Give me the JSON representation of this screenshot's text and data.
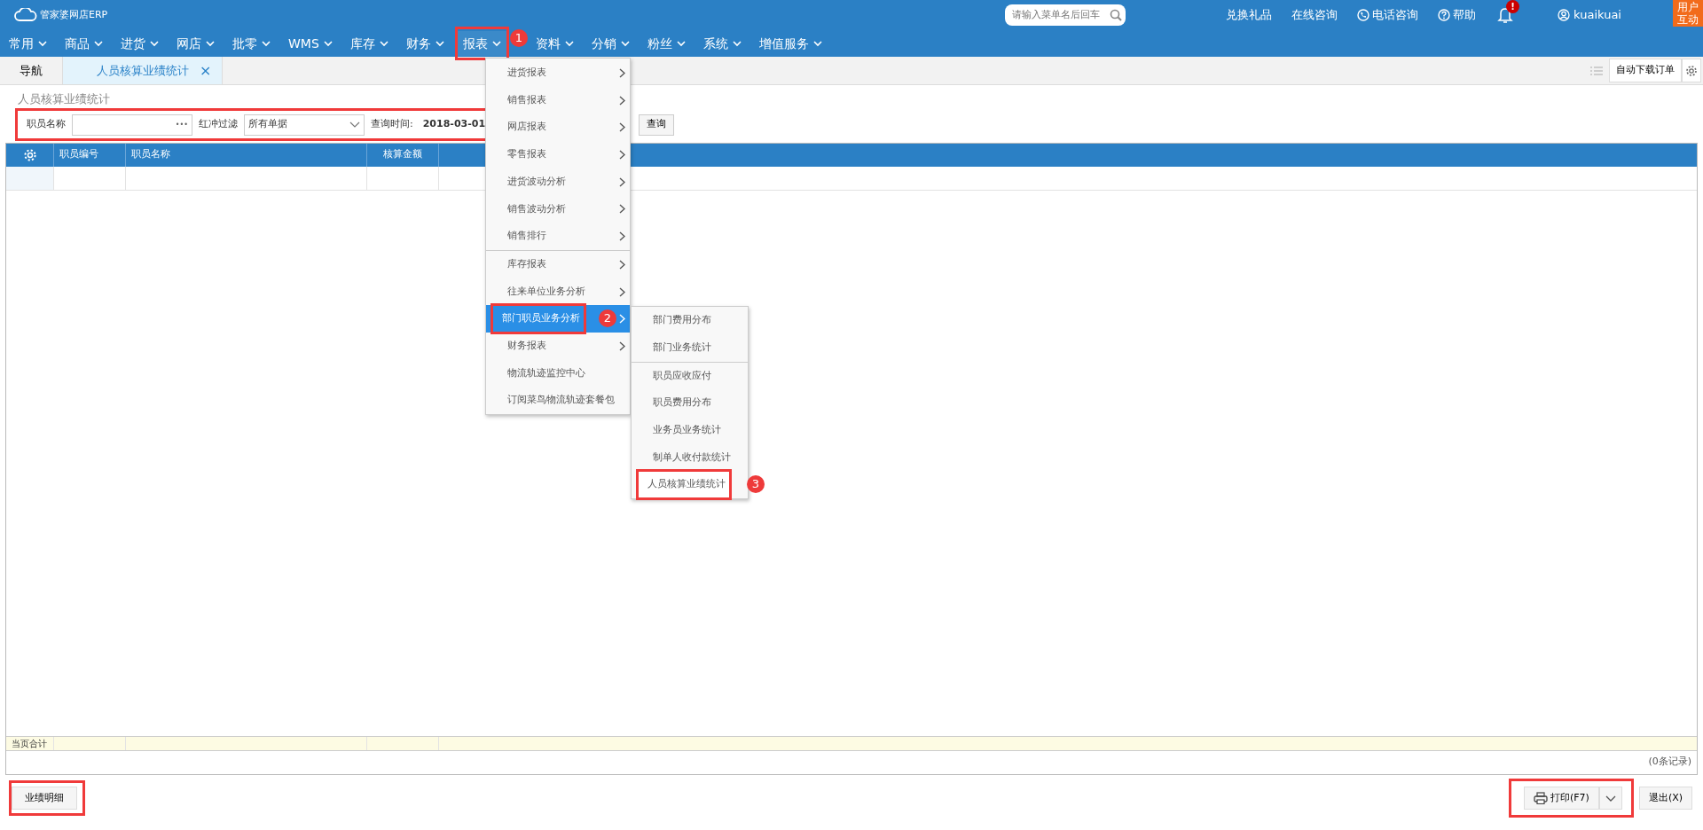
{
  "app": {
    "logo_text": "管家婆网店ERP"
  },
  "search": {
    "placeholder": "请输入菜单名后回车"
  },
  "top_links": [
    {
      "label": "兑换礼品",
      "kind": "text"
    },
    {
      "label": "在线咨询",
      "kind": "text"
    },
    {
      "label": "电话咨询",
      "kind": "phone"
    },
    {
      "label": "帮助",
      "kind": "help"
    }
  ],
  "notifications": {
    "badge": "!"
  },
  "user": {
    "name": "kuaikuai"
  },
  "feedback_button": {
    "label": "用户互动"
  },
  "nav": [
    {
      "label": "常用",
      "selected": false
    },
    {
      "label": "商品",
      "selected": false
    },
    {
      "label": "进货",
      "selected": false
    },
    {
      "label": "网店",
      "selected": false
    },
    {
      "label": "批零",
      "selected": false
    },
    {
      "label": "WMS",
      "selected": false
    },
    {
      "label": "库存",
      "selected": false
    },
    {
      "label": "财务",
      "selected": false
    },
    {
      "label": "报表",
      "selected": true,
      "outlined": true,
      "callout": "1"
    },
    {
      "label": "资料",
      "selected": false
    },
    {
      "label": "分销",
      "selected": false
    },
    {
      "label": "粉丝",
      "selected": false
    },
    {
      "label": "系统",
      "selected": false
    },
    {
      "label": "增值服务",
      "selected": false
    }
  ],
  "tabs": [
    {
      "label": "导航",
      "selected": false
    },
    {
      "label": "人员核算业绩统计",
      "selected": true,
      "close": "×"
    }
  ],
  "tab_toolbar": {
    "button": "自动下载订单"
  },
  "page_title": "人员核算业绩统计",
  "filters": {
    "outlined": true,
    "fields": [
      {
        "kind": "picker",
        "label": "职员名称",
        "dots": "•••"
      },
      {
        "kind": "select",
        "label": "红冲过滤",
        "value": "所有单据"
      },
      {
        "kind": "date",
        "label": "查询时间:",
        "value": "2018-03-01"
      }
    ],
    "query_button": "查询"
  },
  "menu": [
    {
      "label": "进货报表",
      "submenu": true,
      "selected": false
    },
    {
      "label": "销售报表",
      "submenu": true,
      "selected": false
    },
    {
      "label": "网店报表",
      "submenu": true,
      "selected": false
    },
    {
      "label": "零售报表",
      "submenu": true,
      "selected": false
    },
    {
      "label": "进货波动分析",
      "submenu": true,
      "selected": false
    },
    {
      "label": "销售波动分析",
      "submenu": true,
      "selected": false
    },
    {
      "label": "销售排行",
      "submenu": true,
      "selected": false
    },
    {
      "label": "库存报表",
      "submenu": true,
      "selected": false,
      "separator_before": true
    },
    {
      "label": "往来单位业务分析",
      "submenu": true,
      "selected": false
    },
    {
      "label": "部门职员业务分析",
      "submenu": true,
      "selected": true,
      "outlined": true,
      "callout": "2",
      "children": [
        {
          "label": "部门费用分布",
          "selected": false
        },
        {
          "label": "部门业务统计",
          "selected": false
        },
        {
          "label": "职员应收应付",
          "selected": false,
          "separator_before": true
        },
        {
          "label": "职员费用分布",
          "selected": false
        },
        {
          "label": "业务员业务统计",
          "selected": false
        },
        {
          "label": "制单人收付款统计",
          "selected": false
        },
        {
          "label": "人员核算业绩统计",
          "selected": false,
          "outlined": true,
          "callout": "3"
        }
      ]
    },
    {
      "label": "财务报表",
      "submenu": true,
      "selected": false
    },
    {
      "label": "物流轨迹监控中心",
      "submenu": false,
      "selected": false
    },
    {
      "label": "订阅菜鸟物流轨迹套餐包",
      "submenu": false,
      "selected": false
    }
  ],
  "table": {
    "columns": [
      "职员编号",
      "职员名称",
      "核算金额"
    ],
    "footer_label": "当页合计",
    "record_count": "(0条记录)"
  },
  "bottom_left": [
    {
      "label": "业绩明细",
      "outlined": true
    }
  ],
  "bottom_right": [
    {
      "label": "打印(F7)",
      "kind": "print",
      "outlined": true
    },
    {
      "label": "退出(X)",
      "kind": "plain",
      "outlined": false
    }
  ]
}
